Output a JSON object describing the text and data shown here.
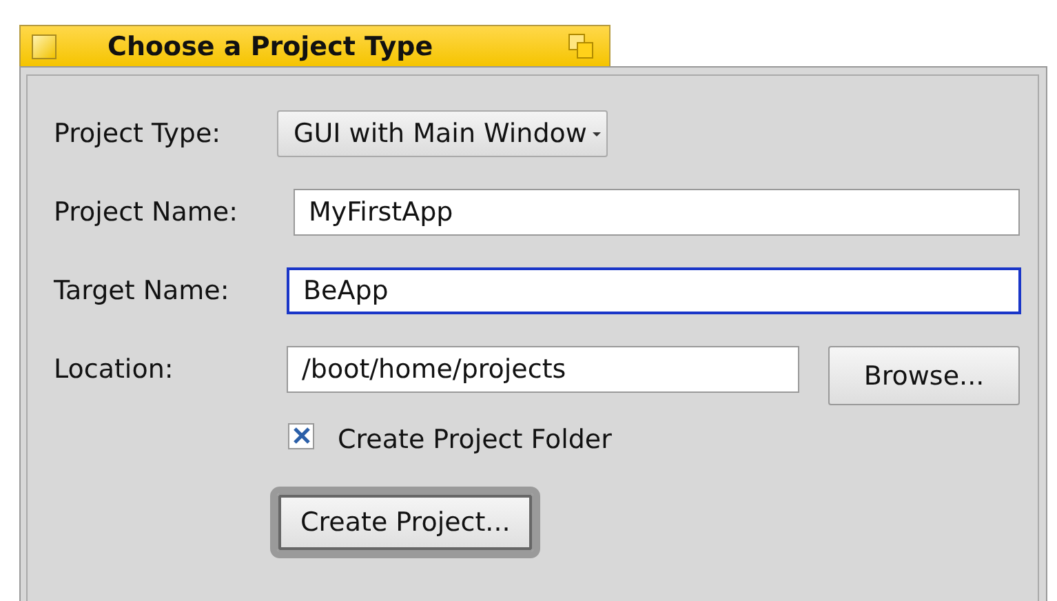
{
  "window": {
    "title": "Choose a Project Type"
  },
  "rows": [
    {
      "kind": "dropdown",
      "label": "Project Type:",
      "value": "GUI with Main Window"
    },
    {
      "kind": "text",
      "label": "Project Name:",
      "value": "MyFirstApp",
      "focused": false
    },
    {
      "kind": "text",
      "label": "Target Name:",
      "value": "BeApp",
      "focused": true
    },
    {
      "kind": "text",
      "label": "Location:",
      "value": "/boot/home/projects",
      "focused": false,
      "button": "Browse..."
    }
  ],
  "checkbox": {
    "label": "Create Project Folder",
    "checked": true
  },
  "default_button": {
    "label": "Create Project...",
    "default": true
  }
}
